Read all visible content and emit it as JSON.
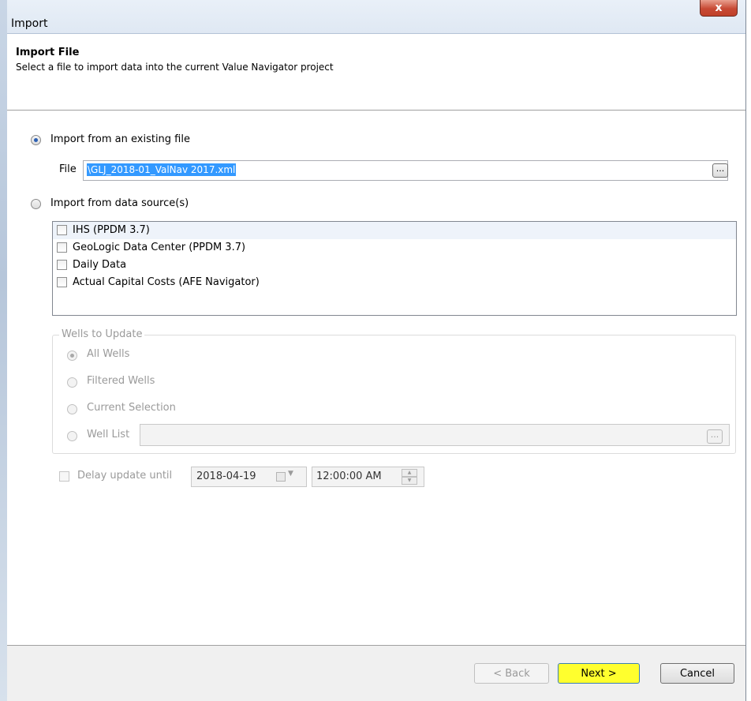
{
  "window": {
    "title": "Import",
    "close_glyph": "x"
  },
  "header": {
    "title": "Import File",
    "subtitle": "Select a file to import data into the current Value Navigator project"
  },
  "import_file": {
    "option_label": "Import from an existing file",
    "file_label": "File",
    "file_value": "\\GLJ_2018-01_ValNav 2017.xml",
    "browse_label": "..."
  },
  "import_source": {
    "option_label": "Import from data source(s)",
    "sources": [
      {
        "label": "IHS (PPDM 3.7)"
      },
      {
        "label": "GeoLogic Data Center (PPDM 3.7)"
      },
      {
        "label": "Daily Data"
      },
      {
        "label": "Actual Capital Costs (AFE Navigator)"
      }
    ]
  },
  "wells_to_update": {
    "group_title": "Wells to Update",
    "options": [
      {
        "label": "All Wells"
      },
      {
        "label": "Filtered Wells"
      },
      {
        "label": "Current Selection"
      },
      {
        "label": "Well List"
      }
    ],
    "well_list_browse": "..."
  },
  "delay": {
    "label": "Delay update until",
    "date": "2018-04-19",
    "time": "12:00:00 AM"
  },
  "footer": {
    "back_label": "< Back",
    "next_label": "Next >",
    "cancel_label": "Cancel"
  },
  "colors": {
    "next_highlight": "#ffff2e",
    "selection": "#3399ff"
  }
}
